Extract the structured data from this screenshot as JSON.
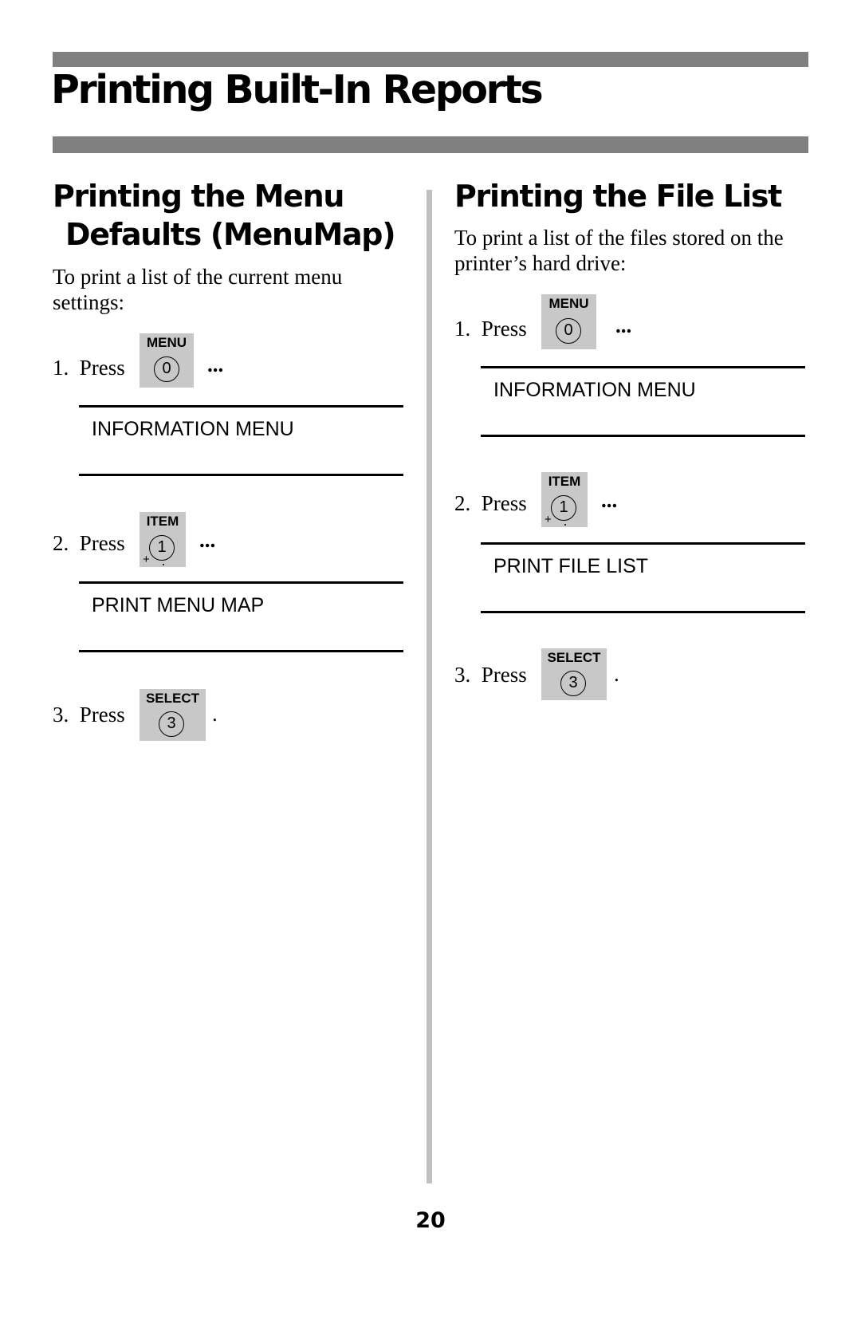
{
  "page": {
    "title": "Printing Built-In Reports",
    "page_number": "20"
  },
  "left": {
    "heading_line1": "Printing the Menu",
    "heading_line2": "Defaults (MenuMap)",
    "intro": "To print a list of the current menu settings:",
    "steps": [
      {
        "number": "1.",
        "verb": "Press",
        "key_label": "MENU",
        "key_digit": "0",
        "after": "...",
        "display": "INFORMATION MENU"
      },
      {
        "number": "2.",
        "verb": "Press",
        "key_label": "ITEM",
        "key_digit": "1",
        "key_plus": "+",
        "after": "...",
        "display": "PRINT MENU MAP"
      },
      {
        "number": "3.",
        "verb": "Press",
        "key_label": "SELECT",
        "key_digit": "3",
        "after": "."
      }
    ]
  },
  "right": {
    "heading": "Printing the File List",
    "intro": "To print a list of the files stored on the printer’s hard drive:",
    "steps": [
      {
        "number": "1.",
        "verb": "Press",
        "key_label": "MENU",
        "key_digit": "0",
        "after": "...",
        "display": "INFORMATION MENU"
      },
      {
        "number": "2.",
        "verb": "Press",
        "key_label": "ITEM",
        "key_digit": "1",
        "key_plus": "+",
        "after": "...",
        "display": "PRINT FILE LIST"
      },
      {
        "number": "3.",
        "verb": "Press",
        "key_label": "SELECT",
        "key_digit": "3",
        "after": "."
      }
    ]
  }
}
